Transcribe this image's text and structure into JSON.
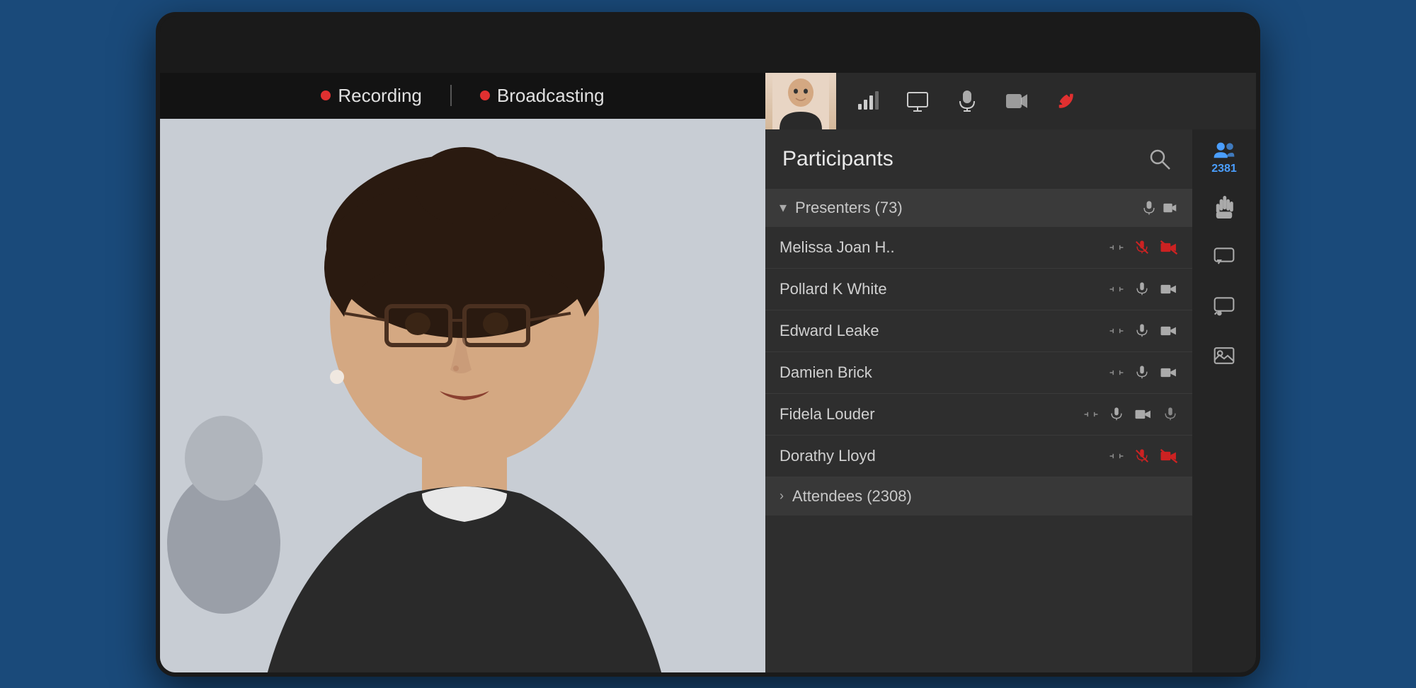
{
  "device": {
    "camera_label": "camera"
  },
  "status_bar": {
    "recording_label": "Recording",
    "broadcasting_label": "Broadcasting"
  },
  "toolbar": {
    "end_call_label": "End Call"
  },
  "participants": {
    "title": "Participants",
    "count": "2381",
    "presenters_label": "Presenters (73)",
    "attendees_label": "Attendees (2308)",
    "list": [
      {
        "name": "Melissa Joan H..",
        "mic_muted": true,
        "cam_muted": true
      },
      {
        "name": "Pollard K White",
        "mic_muted": false,
        "cam_muted": false
      },
      {
        "name": "Edward Leake",
        "mic_muted": false,
        "cam_muted": false
      },
      {
        "name": "Damien Brick",
        "mic_muted": false,
        "cam_muted": false
      },
      {
        "name": "Fidela Louder",
        "mic_muted": false,
        "cam_muted": false
      },
      {
        "name": "Dorathy Lloyd",
        "mic_muted": true,
        "cam_muted": true
      }
    ]
  }
}
